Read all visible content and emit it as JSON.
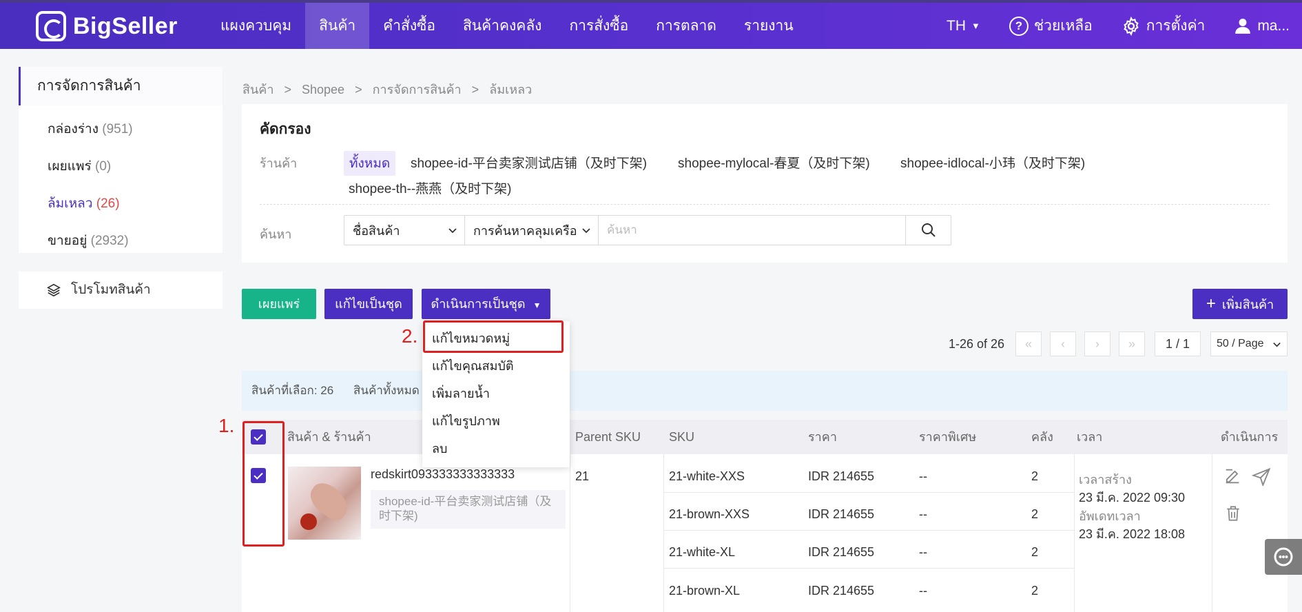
{
  "brand": {
    "name": "BigSeller"
  },
  "nav": {
    "items": [
      "แผงควบคุม",
      "สินค้า",
      "คำสั่งซื้อ",
      "สินค้าคงคลัง",
      "การสั่งซื้อ",
      "การตลาด",
      "รายงาน"
    ],
    "active": "สินค้า",
    "lang": "TH",
    "help": "ช่วยเหลือ",
    "settings": "การตั้งค่า",
    "user": "ma..."
  },
  "sidebar": {
    "title": "การจัดการสินค้า",
    "items": [
      {
        "label": "กล่องร่าง",
        "count": "(951)"
      },
      {
        "label": "เผยแพร่",
        "count": "(0)"
      },
      {
        "label": "ล้มเหลว",
        "count": "(26)"
      },
      {
        "label": "ขายอยู่",
        "count": "(2932)"
      }
    ],
    "promo": "โปรโมทสินค้า"
  },
  "breadcrumb": [
    "สินค้า",
    ">",
    "Shopee",
    ">",
    "การจัดการสินค้า",
    ">",
    "ล้มเหลว"
  ],
  "filter": {
    "title": "คัดกรอง",
    "shop_label": "ร้านค้า",
    "shops": [
      "ทั้งหมด",
      "shopee-id-平台卖家测试店铺（及时下架)",
      "shopee-mylocal-春夏（及时下架)",
      "shopee-idlocal-小玮（及时下架)",
      "shopee-th--燕燕（及时下架)"
    ],
    "search_label": "ค้นหา",
    "search_field": "ชื่อสินค้า",
    "search_mode": "การค้นหาคลุมเครือ",
    "search_placeholder": "ค้นหา"
  },
  "actions": {
    "publish": "เผยแพร่",
    "batch_edit": "แก้ไขเป็นชุด",
    "batch_action": "ดำเนินการเป็นชุด",
    "add_product": "เพิ่มสินค้า",
    "dropdown": [
      "แก้ไขหมวดหมู่",
      "แก้ไขคุณสมบัติ",
      "เพิ่มลายน้ำ",
      "แก้ไขรูปภาพ",
      "ลบ"
    ]
  },
  "annotations": {
    "step1": "1.",
    "step2": "2."
  },
  "pagination": {
    "range": "1-26 of 26",
    "page": "1 / 1",
    "per_page": "50 / Page"
  },
  "selection": {
    "selected": "สินค้าที่เลือก: 26",
    "total": "สินค้าทั้งหมด"
  },
  "table": {
    "headers": [
      "สินค้า & ร้านค้า",
      "Parent SKU",
      "SKU",
      "ราคา",
      "ราคาพิเศษ",
      "คลัง",
      "เวลา",
      "ดำเนินการ"
    ],
    "row": {
      "name": "redskirt093333333333333",
      "shop": "shopee-id-平台卖家测试店铺（及时下架)",
      "parent_sku": "21",
      "variants": [
        {
          "sku": "21-white-XXS",
          "price": "IDR  214655",
          "special": "--",
          "stock": "2"
        },
        {
          "sku": "21-brown-XXS",
          "price": "IDR  214655",
          "special": "--",
          "stock": "2"
        },
        {
          "sku": "21-white-XL",
          "price": "IDR  214655",
          "special": "--",
          "stock": "2"
        },
        {
          "sku": "21-brown-XL",
          "price": "IDR  214655",
          "special": "--",
          "stock": "2"
        }
      ],
      "created_label": "เวลาสร้าง",
      "created": "23 มี.ค. 2022 09:30",
      "updated_label": "อัพเดทเวลา",
      "updated": "23 มี.ค. 2022 18:08"
    }
  },
  "colors": {
    "primary": "#4b2fc2",
    "green": "#17b48a",
    "annotation": "#e02020"
  }
}
